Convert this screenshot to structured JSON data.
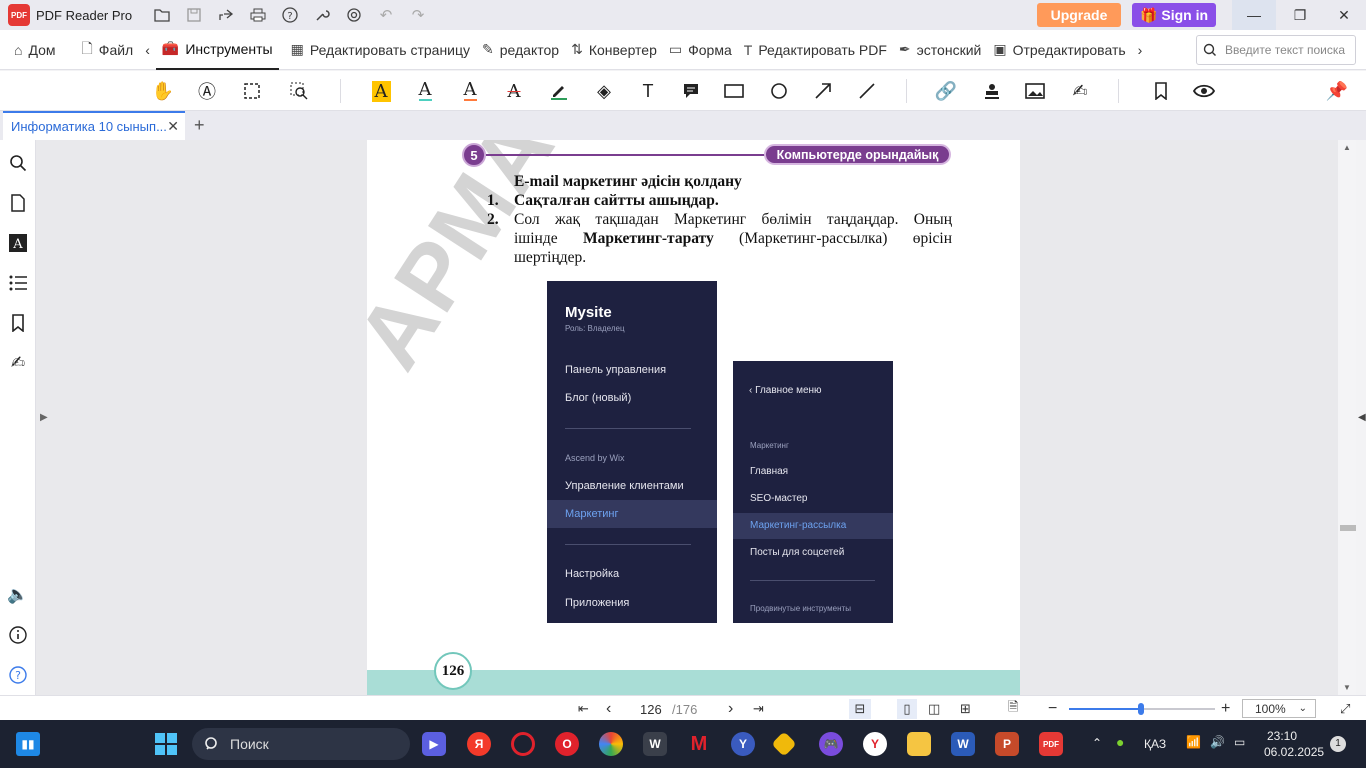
{
  "app": {
    "title": "PDF Reader Pro",
    "logo_text": "PDF",
    "upgrade_label": "Upgrade",
    "signin_label": "Sign in"
  },
  "menu": {
    "items": [
      {
        "label": "Дом",
        "icon": "home-icon"
      },
      {
        "label": "Файл",
        "icon": "file-icon"
      },
      {
        "label": "Инструменты",
        "icon": "toolbox-icon",
        "active": true
      },
      {
        "label": "Редактировать страницу",
        "icon": "grid-icon"
      },
      {
        "label": "редактор",
        "icon": "edit-icon"
      },
      {
        "label": "Конвертер",
        "icon": "convert-icon"
      },
      {
        "label": "Форма",
        "icon": "form-icon"
      },
      {
        "label": "Редактировать PDF",
        "icon": "text-cursor-icon"
      },
      {
        "label": "эстонский",
        "icon": "sign-icon"
      },
      {
        "label": "Отредактировать",
        "icon": "redact-icon"
      }
    ],
    "search_placeholder": "Введите текст поиска"
  },
  "doc_tab": {
    "label": "Информатика 10  сынып..."
  },
  "page": {
    "section_number": "5",
    "section_chip": "Компьютерде орындайық",
    "heading": "E-mail маркетинг әдісін қолдану",
    "step1_num": "1.",
    "step1": "Сақталған сайтты ашыңдар.",
    "step2_num": "2.",
    "step2_line1": "Сол жақ тақшадан Маркетинг бөлімін таңдаңдар. Оның",
    "step2_line2a": "ішінде ",
    "step2_line2b": "Маркетинг-тарату",
    "step2_line2c": " (Маркетинг-рассылка) өрісін",
    "step2_line3": "шертіңдер.",
    "watermark": "АРМАН-ПВ",
    "page_number": "126",
    "left_panel": {
      "site": "Mysite",
      "role": "Роль: Владелец",
      "items": [
        "Панель управления",
        "Блог (новый)",
        "Ascend by Wix",
        "Управление клиентами",
        "Маркетинг",
        "Настройка",
        "Приложения"
      ]
    },
    "right_panel": {
      "back": "Главное меню",
      "section": "Маркетинг",
      "items": [
        "Главная",
        "SEO-мастер",
        "Маркетинг-рассылка",
        "Посты для соцсетей",
        "Продвинутые инструменты"
      ]
    }
  },
  "status": {
    "current_page": "126",
    "total_pages": "/176",
    "zoom": "100%",
    "zoom_fraction": 0.49
  },
  "taskbar": {
    "search_label": "Поиск",
    "lang": "ҚАЗ",
    "time": "23:10",
    "date": "06.02.2025",
    "notifications": "1"
  },
  "colors": {
    "accent": "#3c7bea",
    "upgrade": "#ff9a5a",
    "signin": "#8a4fe8",
    "chip_purple": "#7a3d8f",
    "panel_navy": "#1e2140",
    "teal": "#a9ddd6"
  }
}
